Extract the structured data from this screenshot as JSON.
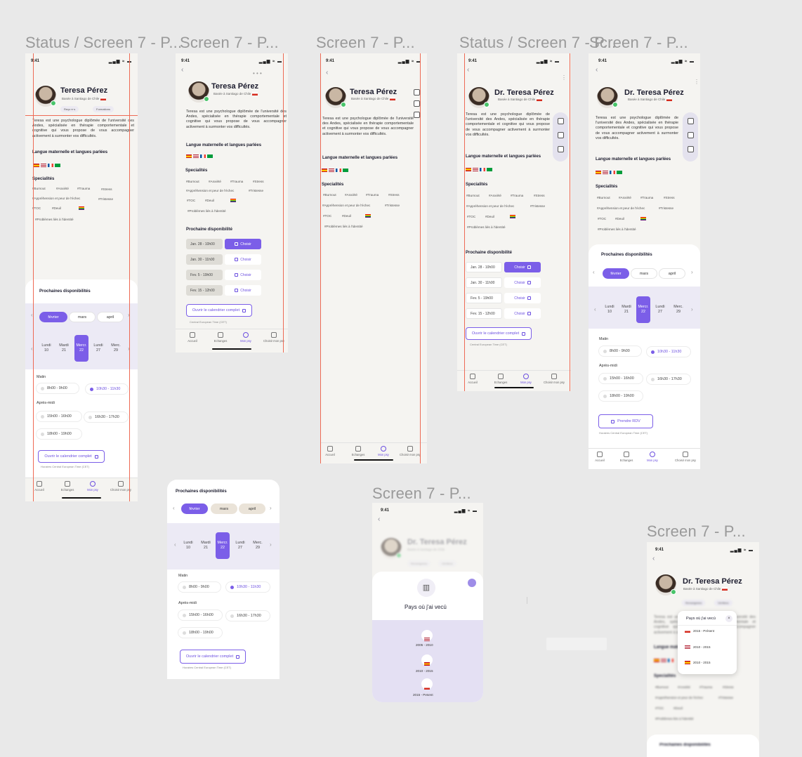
{
  "frames": {
    "f1": {
      "label": "Status / Screen 7 - P..."
    },
    "f2": {
      "label": "Screen 7 - P..."
    },
    "f3": {
      "label": "Screen 7 - P..."
    },
    "f4": {
      "label": "Status / Screen 7 - P..."
    },
    "f5": {
      "label": "Screen 7 - P..."
    },
    "f7": {
      "label": "Screen 7 - P..."
    },
    "f8": {
      "label": "Screen 7 - P..."
    }
  },
  "status_time": "9:41",
  "status_icons": "▂▄▆ ≈ ▬",
  "profile": {
    "name": "Teresa Pérez",
    "name_dr": "Dr. Teresa Pérez",
    "location": "Basée à Santiago de Chile",
    "pill_1": "Reçu·e·s",
    "pill_2": "Formations",
    "pill_3": "Renseignées",
    "pill_4": "Vérifiées",
    "bio": "Teresa est une psychologue diplômée de l'université des Andes, spécialisée en thérapie comportementale et cognitive qui vous propose de vous accompagner activement à surmonter vos difficultés."
  },
  "sections": {
    "languages": "Langue maternelle et langues parlées",
    "specialties": "Specialités",
    "next_avail": "Prochaine disponibilité",
    "next_avails": "Prochaines disponibilités"
  },
  "tags": {
    "burnout": "#Burnout",
    "anxiete": "#Anxiété",
    "trauma": "#Trauma",
    "stress": "#Stress",
    "apprehension": "#Appréhension et peur de l'échec",
    "tristesse": "#Tristesse",
    "toc": "#TOC",
    "deuil": "#Deuil",
    "identite": "#Problèmes liés à l'identité"
  },
  "slots": {
    "s1": "Jan. 28 - 10h00",
    "s2": "Jan. 30 - 11h00",
    "s3": "Fev. 5 - 19h00",
    "s4": "Fev. 15 - 12h00",
    "choose": "Choisir"
  },
  "open_calendar": "Ouvrir le calendrier complet",
  "timezone": "Central European Time (CET)",
  "timezone_full": "Horaires Central European Time (CET)",
  "months": {
    "m1": "février",
    "m2": "mars",
    "m3": "april",
    "m3_fr": "avril"
  },
  "days": {
    "d1_w": "Lundi",
    "d1_n": "10",
    "d2_w": "Mardi",
    "d2_n": "21",
    "d3_w": "Mercr.",
    "d3_n": "22",
    "d4_w": "Lundi",
    "d4_n": "27",
    "d5_w": "Merc.",
    "d5_n": "29"
  },
  "periods": {
    "morning": "Matin",
    "afternoon": "Après-midi"
  },
  "times": {
    "t1": "8h00 - 9h00",
    "t2": "10h30 - 11h30",
    "t3": "15h00 - 16h00",
    "t4": "16h30 - 17h30",
    "t5": "18h00 - 19h00"
  },
  "book_button": "Prendre RDV",
  "tabs": {
    "home": "Accueil",
    "exchanges": "Echanges",
    "mypsy": "Mon psy",
    "choose": "Choisir mon psy"
  },
  "countries": {
    "title": "Pays où j'ai vecú",
    "p1": "2005 - 2010",
    "p2": "2010 - 2015",
    "p3": "2015 - Pesent",
    "p1_popup": "2015 - Présent",
    "p2_popup": "2010 - 2015",
    "p3_popup": "2010 - 2015",
    "close": "×"
  },
  "colors": {
    "accent": "#7b5ee8",
    "guide": "#ee6a55",
    "canvas": "#e9e9e9",
    "screen": "#f5f4f1"
  }
}
